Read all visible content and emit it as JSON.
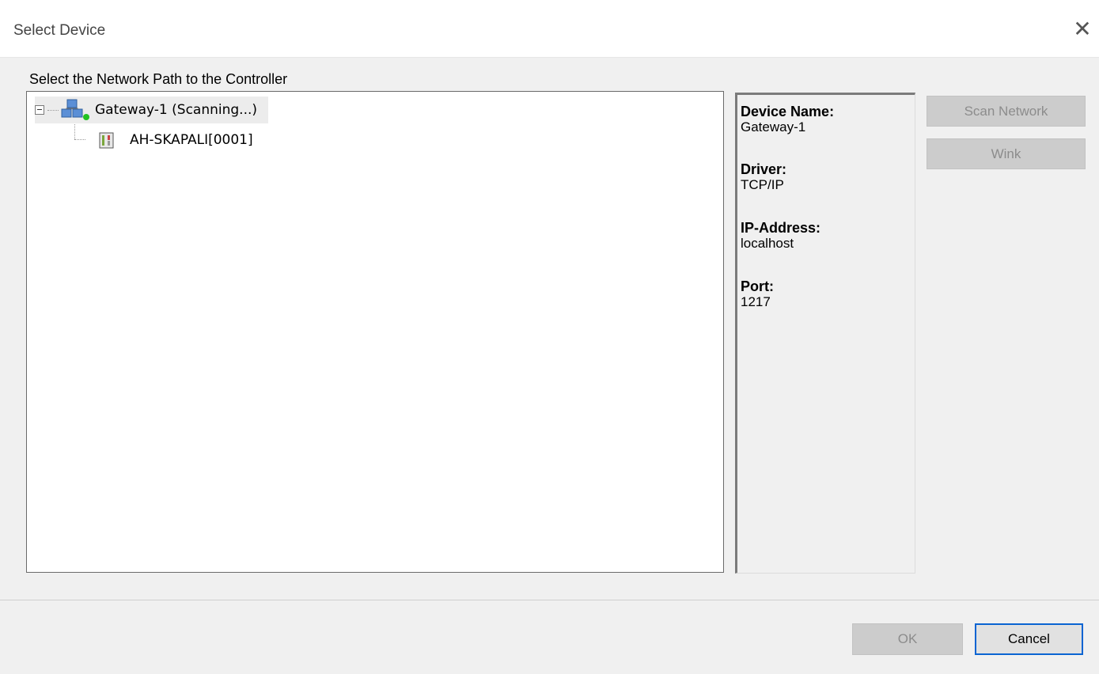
{
  "dialog": {
    "title": "Select Device",
    "close_glyph": "✕"
  },
  "path_label": "Select the Network Path to the Controller",
  "tree": {
    "gateway": {
      "label": "Gateway-1 (Scanning...)",
      "icon": "network-gateway-icon",
      "status_color": "#22c222"
    },
    "device": {
      "label": "AH-SKAPALI[0001]",
      "icon": "controller-device-icon"
    }
  },
  "info": [
    {
      "key": "Device Name:",
      "value": "Gateway-1"
    },
    {
      "key": "Driver:",
      "value": "TCP/IP"
    },
    {
      "key": "IP-Address:",
      "value": "localhost"
    },
    {
      "key": "Port:",
      "value": "1217"
    }
  ],
  "buttons": {
    "scan": "Scan Network",
    "wink": "Wink",
    "ok": "OK",
    "cancel": "Cancel"
  },
  "colors": {
    "focus_border": "#0a64d2",
    "disabled_bg": "#cccccc"
  }
}
